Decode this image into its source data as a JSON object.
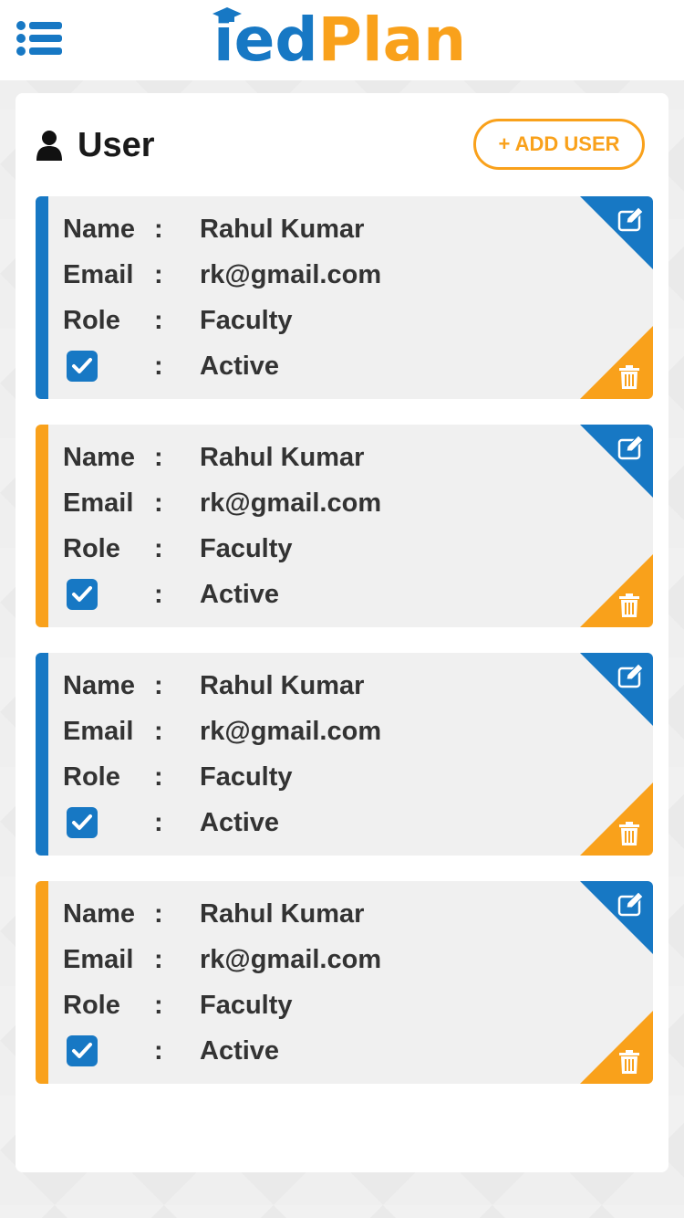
{
  "header": {
    "logo_part1": "ied",
    "logo_part2": "Plan",
    "menu_icon": "hamburger-list-icon"
  },
  "page": {
    "title": "User",
    "title_icon": "user-icon",
    "add_button_label": "+ ADD USER"
  },
  "labels": {
    "name": "Name",
    "email": "Email",
    "role": "Role",
    "separator": ":"
  },
  "users": [
    {
      "name": "Rahul Kumar",
      "email": "rk@gmail.com",
      "role": "Faculty",
      "status": "Active",
      "active": true,
      "accent": "#1778c4"
    },
    {
      "name": "Rahul Kumar",
      "email": "rk@gmail.com",
      "role": "Faculty",
      "status": "Active",
      "active": true,
      "accent": "#f9a11b"
    },
    {
      "name": "Rahul Kumar",
      "email": "rk@gmail.com",
      "role": "Faculty",
      "status": "Active",
      "active": true,
      "accent": "#1778c4"
    },
    {
      "name": "Rahul Kumar",
      "email": "rk@gmail.com",
      "role": "Faculty",
      "status": "Active",
      "active": true,
      "accent": "#f9a11b"
    }
  ],
  "colors": {
    "primary_blue": "#1778c4",
    "accent_orange": "#f9a11b",
    "card_bg": "#f0f0f0",
    "text_dark": "#333333"
  },
  "icons": {
    "edit": "edit-icon",
    "delete": "trash-icon",
    "check": "checkbox-checked-icon"
  }
}
